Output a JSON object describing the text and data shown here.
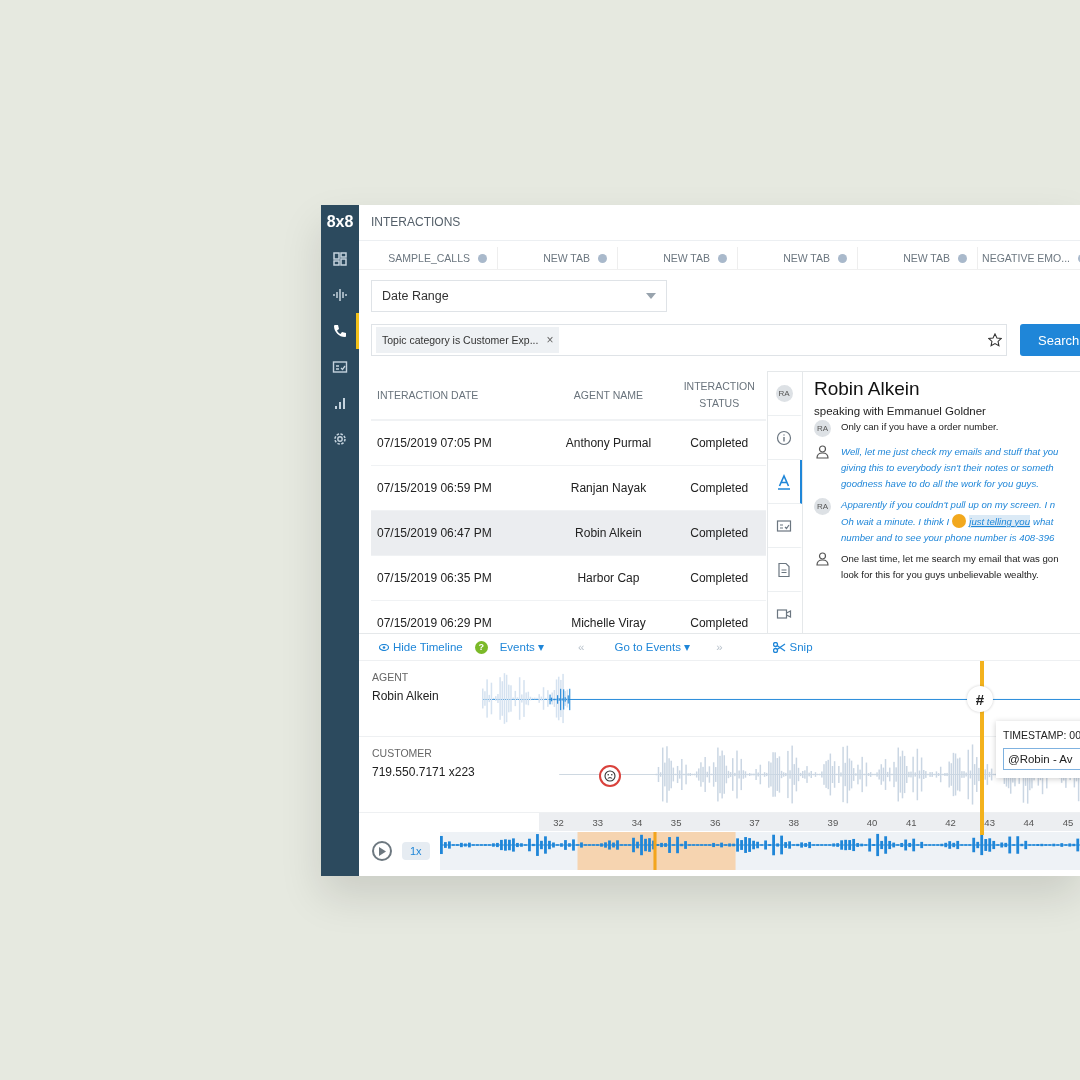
{
  "sidebar": {
    "logo": "8x8",
    "items": [
      {
        "selected": false
      },
      {
        "selected": false
      },
      {
        "selected": true
      },
      {
        "selected": false
      },
      {
        "selected": false
      },
      {
        "selected": false
      }
    ]
  },
  "header": {
    "title": "INTERACTIONS"
  },
  "tabs": [
    {
      "label": "SAMPLE_CALLS"
    },
    {
      "label": "NEW TAB"
    },
    {
      "label": "NEW TAB"
    },
    {
      "label": "NEW TAB"
    },
    {
      "label": "NEW TAB"
    },
    {
      "label": "NEGATIVE EMO..."
    }
  ],
  "date_range": {
    "value": "Date Range"
  },
  "filter": {
    "chip": "Topic category is Customer Exp...",
    "chip_close": "×",
    "search_button": "Search"
  },
  "table": {
    "columns": [
      "INTERACTION DATE",
      "AGENT NAME",
      "INTERACTION STATUS"
    ],
    "rows": [
      {
        "cells": [
          "07/15/2019 07:05 PM",
          "Anthony Purmal",
          "Completed"
        ],
        "selected": false
      },
      {
        "cells": [
          "07/15/2019 06:59 PM",
          "Ranjan Nayak",
          "Completed"
        ],
        "selected": false
      },
      {
        "cells": [
          "07/15/2019 06:47 PM",
          "Robin Alkein",
          "Completed"
        ],
        "selected": true
      },
      {
        "cells": [
          "07/15/2019 06:35 PM",
          "Harbor Cap",
          "Completed"
        ],
        "selected": false
      },
      {
        "cells": [
          "07/15/2019 06:29 PM",
          "Michelle Viray",
          "Completed"
        ],
        "selected": false
      }
    ]
  },
  "detail": {
    "avatar": "RA",
    "tools": [
      {
        "selected": false
      },
      {
        "selected": true
      },
      {
        "selected": false
      },
      {
        "selected": false
      },
      {
        "selected": false
      }
    ],
    "title": "Robin Alkein",
    "subtitle": "speaking with Emmanuel Goldner",
    "messages": [
      {
        "kind": "agent",
        "avatar": "RA",
        "italic": false,
        "lines": [
          {
            "text": "Only can if you have a order number."
          }
        ]
      },
      {
        "kind": "customer",
        "italic": true,
        "lines": [
          {
            "text": "Well, let me just check my emails and stuff that you"
          },
          {
            "text": "giving this to everybody isn't their notes or someth"
          },
          {
            "text": "goodness have to do all the work for you guys."
          }
        ]
      },
      {
        "kind": "agent",
        "avatar": "RA",
        "italic": true,
        "lines": [
          {
            "text": "Apparently if you couldn't pull up on my screen. I n"
          },
          {
            "text": "Oh wait a minute. I think I",
            "highlight": "just telling you",
            "after": "what"
          },
          {
            "text": "number and to see your phone number is 408-396"
          }
        ]
      },
      {
        "kind": "customer",
        "italic": false,
        "lines": [
          {
            "text": "One last time, let me search my email that was gon"
          },
          {
            "text": "look for this for you guys unbelievable wealthy."
          }
        ]
      }
    ]
  },
  "timeline_toolbar": {
    "hide": "Hide Timeline",
    "help": "?",
    "events": "Events",
    "events_caret": "▾",
    "goto_caret": "▾",
    "prev": "«",
    "goto": "Go to Events",
    "next": "»",
    "snip": "Snip"
  },
  "tracks": [
    {
      "role": "AGENT",
      "name": "Robin Alkein",
      "kind": "agent"
    },
    {
      "role": "CUSTOMER",
      "name": "719.550.7171 x223",
      "kind": "customer"
    }
  ],
  "axis": [
    "32",
    "33",
    "34",
    "35",
    "36",
    "37",
    "38",
    "39",
    "40",
    "41",
    "42",
    "43",
    "44",
    "45"
  ],
  "marker": "#",
  "popup": {
    "label": "TIMESTAMP: 00",
    "value": "@Robin - Av"
  },
  "player": {
    "speed": "1x"
  }
}
